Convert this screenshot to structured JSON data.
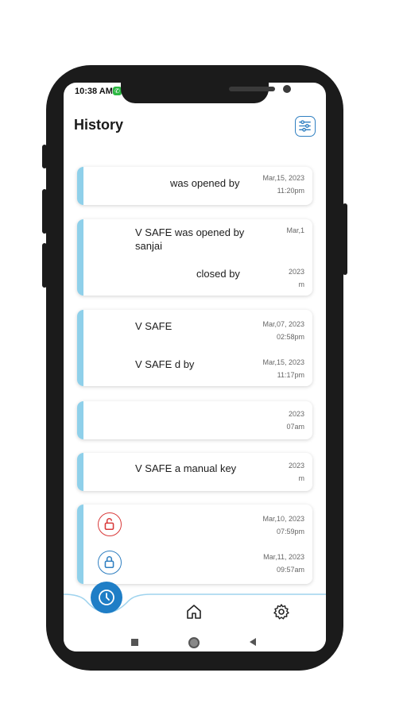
{
  "status": {
    "time": "10:38 AM"
  },
  "header": {
    "title": "History"
  },
  "cards": [
    {
      "entries": [
        {
          "message": "was opened by",
          "date": "Mar,15, 2023",
          "time": "11:20pm"
        }
      ]
    },
    {
      "entries": [
        {
          "message": "V SAFE was opened by sanjai",
          "date": "Mar,1",
          "time": ""
        },
        {
          "message": "closed by",
          "date": "2023",
          "time": "m"
        }
      ]
    },
    {
      "entries": [
        {
          "message": "V SAFE",
          "date": "Mar,07, 2023",
          "time": "02:58pm"
        },
        {
          "message": "V SAFE d by",
          "date": "Mar,15, 2023",
          "time": "11:17pm"
        }
      ]
    },
    {
      "entries": [
        {
          "message": "",
          "date": "2023",
          "time": "07am"
        }
      ]
    },
    {
      "entries": [
        {
          "message": "V SAFE a manual key",
          "date": "2023",
          "time": "m"
        }
      ]
    },
    {
      "entries": [
        {
          "message": "",
          "date": "Mar,10, 2023",
          "time": "07:59pm",
          "lock": "unlocked"
        },
        {
          "message": "",
          "date": "Mar,11, 2023",
          "time": "09:57am",
          "lock": "locked"
        }
      ]
    }
  ],
  "colors": {
    "accent": "#1f7ec6",
    "bar": "#8fd0ea",
    "unlock": "#d93a3a",
    "lock": "#2f7fc1"
  },
  "icons": {
    "filter": "filter-icon",
    "clock": "clock-icon",
    "home": "home-icon",
    "settings": "gear-icon"
  }
}
